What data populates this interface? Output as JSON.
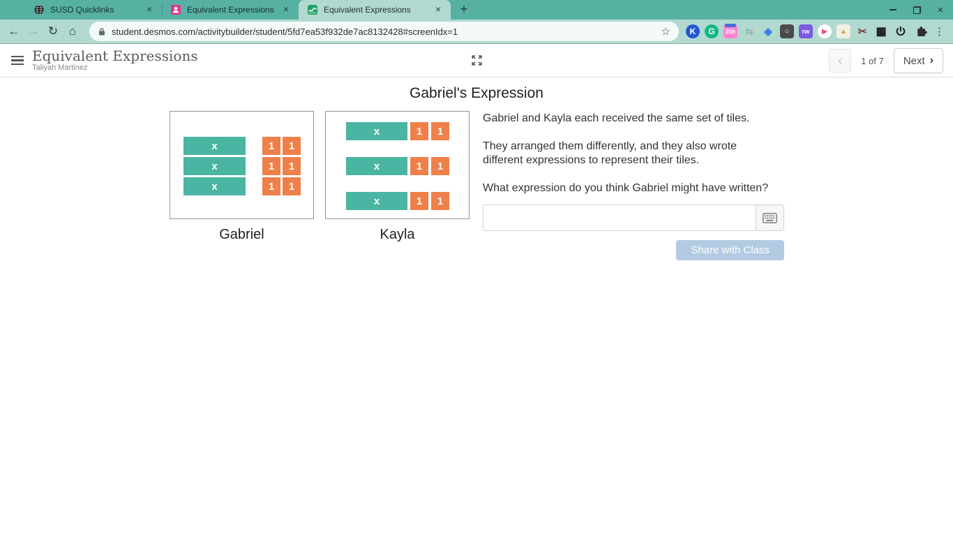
{
  "colors": {
    "chrome_frame": "#57b1a3",
    "chrome_toolbar": "#b2d9d0",
    "tile_teal": "#4ab5a2",
    "tile_orange": "#ef8049",
    "accent_share": "#b3cbe2",
    "desmos_green": "#21a06b",
    "person_pink": "#e5328c"
  },
  "browser": {
    "tabs": [
      {
        "title": "SUSD Quicklinks"
      },
      {
        "title": "Equivalent Expressions"
      },
      {
        "title": "Equivalent Expressions"
      }
    ],
    "new_tab_glyph": "+",
    "close_glyph": "×",
    "url": "student.desmos.com/activitybuilder/student/5fd7ea53f932de7ac8132428#screenIdx=1",
    "nav": {
      "back": "←",
      "forward": "→",
      "reload": "↻",
      "home": "⌂",
      "star": "☆",
      "kebab": "⋮"
    },
    "extensions": [
      {
        "name": "kami-extension-icon",
        "glyph": "K",
        "bg": "#2257d2",
        "fg": "#ffffff",
        "round": true,
        "size": 12
      },
      {
        "name": "grammarly-extension-icon",
        "glyph": "G",
        "bg": "#12b886",
        "fg": "#ffffff",
        "round": true,
        "size": 12
      },
      {
        "name": "screencast-20h-extension-icon",
        "glyph": "20h",
        "bg": "#ff85d0",
        "fg": "#ffffff",
        "round": false,
        "size": 8,
        "topbar": "#4f6bd8"
      },
      {
        "name": "sync-gray-extension-icon",
        "glyph": "⇆",
        "bg": "transparent",
        "fg": "#8fb5ad",
        "round": false,
        "size": 14
      },
      {
        "name": "blue-gem-extension-icon",
        "glyph": "◆",
        "bg": "transparent",
        "fg": "#3f7fe8",
        "round": false,
        "size": 15
      },
      {
        "name": "camera-dark-extension-icon",
        "glyph": "○",
        "bg": "#4a4a4a",
        "fg": "#ffffff",
        "round": false,
        "size": 11
      },
      {
        "name": "read-write-extension-icon",
        "glyph": "rw",
        "bg": "#7b5be0",
        "fg": "#ffffff",
        "round": false,
        "size": 9
      },
      {
        "name": "play-pink-extension-icon",
        "glyph": "▶",
        "bg": "#ffffff",
        "fg": "#e8587a",
        "round": true,
        "size": 10
      },
      {
        "name": "jar-extension-icon",
        "glyph": "▲",
        "bg": "#f1efe3",
        "fg": "#e09c3a",
        "round": false,
        "size": 10
      },
      {
        "name": "scissors-extension-icon",
        "glyph": "✂",
        "bg": "transparent",
        "fg": "#7a3b3b",
        "round": false,
        "size": 15
      },
      {
        "name": "qr-code-extension-icon",
        "glyph": "▦",
        "bg": "transparent",
        "fg": "#111111",
        "round": false,
        "size": 16
      },
      {
        "name": "power-extension-icon",
        "svg": "power"
      },
      {
        "name": "extensions-puzzle-icon",
        "svg": "puzzle"
      }
    ]
  },
  "header": {
    "title": "Equivalent Expressions",
    "student": "Taliyah Martinez",
    "page_indicator": "1 of 7",
    "next_label": "Next",
    "prev_glyph": "‹",
    "next_glyph": "›"
  },
  "screen": {
    "title": "Gabriel's Expression",
    "tiles": {
      "x_label": "x",
      "one_label": "1",
      "gabriel": {
        "label": "Gabriel",
        "x_count": 3,
        "one_rows": 3,
        "one_cols": 2
      },
      "kayla": {
        "label": "Kayla",
        "row_count": 3,
        "ones_per_row": 2
      }
    },
    "paragraphs": [
      "Gabriel and Kayla each received the same set of tiles.",
      "They arranged them differently, and they also wrote different expressions to represent their tiles.",
      "What expression do you think Gabriel might have written?"
    ],
    "input": {
      "value": ""
    },
    "share_label": "Share with Class"
  }
}
